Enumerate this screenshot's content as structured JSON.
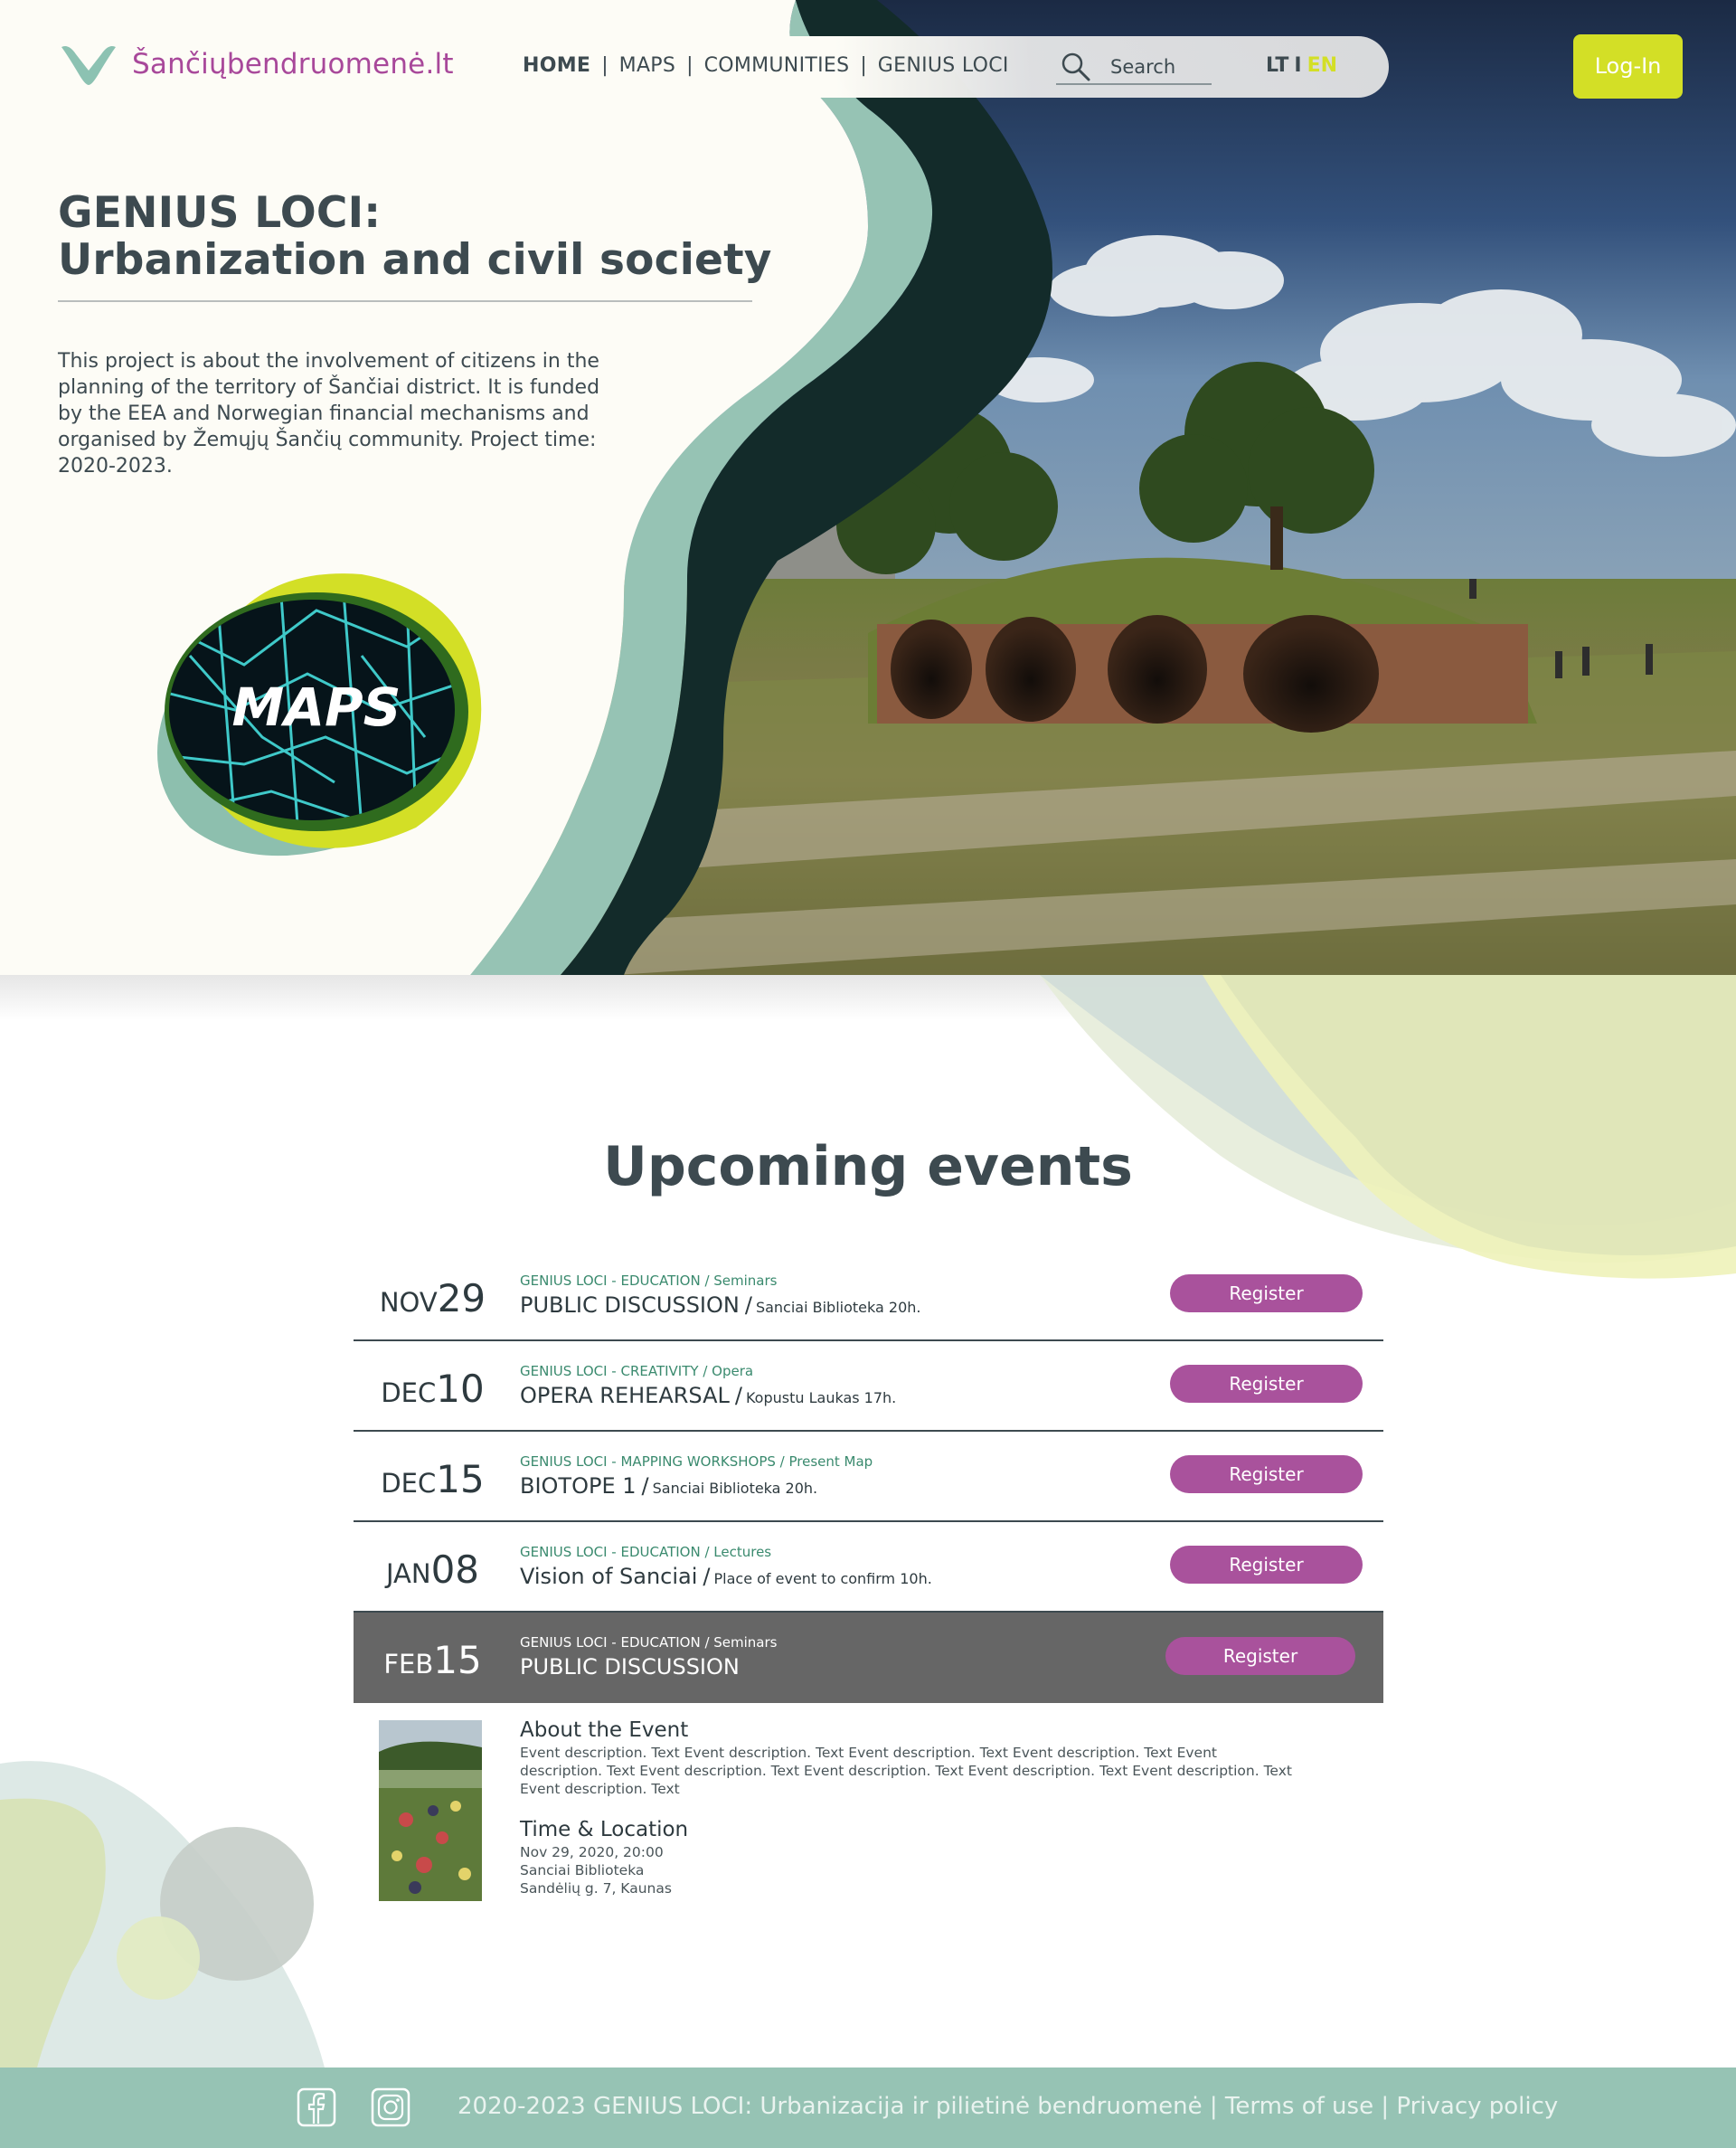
{
  "brand": {
    "logo_icon": "check-icon",
    "site_name": "Šančiųbendruomenė.lt"
  },
  "nav": {
    "links": [
      "HOME",
      "MAPS",
      "COMMUNITIES",
      "GENIUS LOCI"
    ],
    "active": "HOME",
    "search_placeholder": "Search",
    "lang_lt": "LT",
    "lang_sep": "I",
    "lang_en": "EN",
    "login": "Log-In"
  },
  "hero": {
    "title_line1": "GENIUS LOCI:",
    "title_line2": "Urbanization and civil society",
    "description": "This project is about the involvement of citizens in the planning of the territory of Šančiai district. It is funded by the EEA and Norwegian financial mechanisms and organised by Žemųjų Šančių community. Project time: 2020-2023.",
    "maps_badge": "MAPS"
  },
  "events": {
    "title": "Upcoming events",
    "items": [
      {
        "month": "NOV",
        "day": "29",
        "category": "GENIUS LOCI - EDUCATION / Seminars",
        "title": "PUBLIC DISCUSSION",
        "slash": "/",
        "place": "Sanciai Biblioteka 20h.",
        "button": "Register"
      },
      {
        "month": "DEC",
        "day": "10",
        "category": "GENIUS LOCI - CREATIVITY  / Opera",
        "title": "OPERA REHEARSAL",
        "slash": "/",
        "place": "Kopustu Laukas 17h.",
        "button": "Register"
      },
      {
        "month": "DEC",
        "day": "15",
        "category": "GENIUS LOCI - MAPPING WORKSHOPS /  Present Map",
        "title": "BIOTOPE 1",
        "slash": "/",
        "place": "Sanciai Biblioteka 20h.",
        "button": "Register"
      },
      {
        "month": "JAN",
        "day": "08",
        "category": "GENIUS LOCI - EDUCATION / Lectures",
        "title": "Vision of Sanciai",
        "slash": "/",
        "place": "Place of event to confirm 10h.",
        "button": "Register"
      },
      {
        "month": "FEB",
        "day": "15",
        "category": "GENIUS LOCI - EDUCATION / Seminars",
        "title": "PUBLIC DISCUSSION",
        "slash": "",
        "place": "",
        "button": "Register",
        "highlighted": true
      }
    ]
  },
  "details": {
    "about_heading": "About the Event",
    "about_text": "Event description. Text  Event description. Text Event description. Text Event description. Text Event description. Text Event description. Text  Event description. Text Event description. Text Event description. Text Event description. Text",
    "time_heading": "Time & Location",
    "time_line1": "Nov 29, 2020, 20:00",
    "time_line2": "Sanciai Biblioteka",
    "time_line3": "Sandėlių g. 7, Kaunas"
  },
  "footer": {
    "icons": [
      "facebook-icon",
      "instagram-icon"
    ],
    "copyright": "2020-2023 GENIUS LOCI: Urbanizacija ir pilietinė bendruomenė",
    "sep1": "|",
    "terms": "Terms of use",
    "sep2": "|",
    "privacy": "Privacy policy"
  },
  "colors": {
    "brand_purple": "#a8489a",
    "lime": "#d3df26",
    "teal": "#96c3b4",
    "dark_text": "#3d4a50",
    "button_purple": "#a9529c",
    "highlight_row": "#666666"
  }
}
